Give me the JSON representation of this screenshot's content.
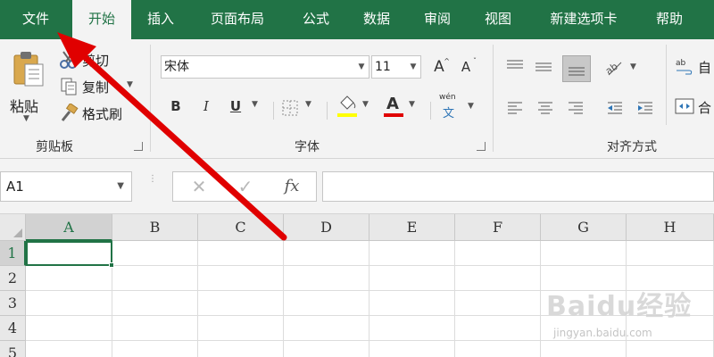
{
  "tabs": [
    "文件",
    "开始",
    "插入",
    "页面布局",
    "公式",
    "数据",
    "审阅",
    "视图",
    "新建选项卡",
    "帮助"
  ],
  "active_tab": "开始",
  "clipboard": {
    "paste": "粘贴",
    "cut": "剪切",
    "copy": "复制",
    "format_painter": "格式刷",
    "label": "剪贴板"
  },
  "font": {
    "family": "宋体",
    "size": "11",
    "bold": "B",
    "italic": "I",
    "underline": "U",
    "label": "字体",
    "phonetic_top": "wén",
    "phonetic_bottom": "文",
    "font_color_letter": "A",
    "grow": "A",
    "shrink": "A"
  },
  "alignment": {
    "label": "对齐方式",
    "wrap_text": "自",
    "merge": "合",
    "wrap_icon_text": "ab"
  },
  "formula_bar": {
    "name_box": "A1",
    "cancel": "✕",
    "enter": "✓",
    "fx": "fx",
    "value": ""
  },
  "grid": {
    "columns": [
      "A",
      "B",
      "C",
      "D",
      "E",
      "F",
      "G",
      "H"
    ],
    "rows": [
      "1",
      "2",
      "3",
      "4",
      "5"
    ],
    "active_cell": "A1"
  },
  "watermark": {
    "brand": "Baidu经验",
    "url": "jingyan.baidu.com"
  },
  "colors": {
    "excel_green": "#217346",
    "arrow_red": "#e00000",
    "highlight_yellow": "#ffff00",
    "font_red": "#e00000"
  }
}
